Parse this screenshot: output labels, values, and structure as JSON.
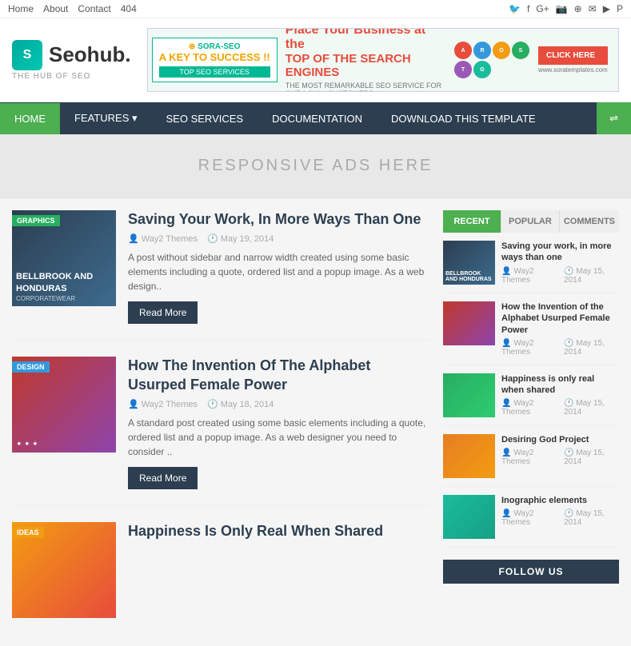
{
  "topNav": {
    "items": [
      "Home",
      "About",
      "Contact",
      "404"
    ]
  },
  "topSocial": {
    "icons": [
      "twitter",
      "facebook",
      "google-plus",
      "instagram",
      "rss",
      "email",
      "youtube",
      "pinterest"
    ]
  },
  "header": {
    "logoText": "Seohub.",
    "logoSub": "THE HUB OF SEO",
    "banner": {
      "leftTop": "SORA-SEO",
      "leftTagline": "A KEY TO SUCCESS !!",
      "leftButton": "TOP SEO SERVICES",
      "midPrefix": "Place Your Business at the",
      "midHighlight": "TOP OF THE SEARCH ENGINES",
      "midSub": "THE MOST REMARKABLE SEO SERVICE FOR OUR LOYAL CUSTOMERS",
      "ctaButton": "CLICK HERE",
      "url": "www.soratemplates.com"
    }
  },
  "nav": {
    "items": [
      {
        "label": "HOME",
        "active": true
      },
      {
        "label": "FEATURES ▾",
        "active": false
      },
      {
        "label": "SEO SERVICES",
        "active": false
      },
      {
        "label": "DOCUMENTATION",
        "active": false
      },
      {
        "label": "DOWNLOAD THIS TEMPLATE",
        "active": false
      }
    ],
    "shuffleIcon": "⇌"
  },
  "adBanner": {
    "text": "RESPONSIVE ADS HERE"
  },
  "posts": [
    {
      "tag": "GRAPHICS",
      "tagType": "graphics",
      "thumbText": "BELLBROOK AND HONDURAS",
      "thumbSub": "CORPORATEWEAR",
      "title": "Saving Your Work, In More Ways Than One",
      "author": "Way2 Themes",
      "date": "May 19, 2014",
      "excerpt": "A post without sidebar and narrow width created using some basic elements including a quote, ordered list and a popup image. As a web design..",
      "readMore": "Read More"
    },
    {
      "tag": "DESIGN",
      "tagType": "design",
      "thumbText": "",
      "thumbSub": "",
      "title": "How The Invention Of The Alphabet Usurped Female Power",
      "author": "Way2 Themes",
      "date": "May 18, 2014",
      "excerpt": "A standard post created using some basic elements including a quote, ordered list and a popup image. As a web designer you need to consider ..",
      "readMore": "Read More"
    },
    {
      "tag": "IDEAS",
      "tagType": "ideas",
      "thumbText": "",
      "thumbSub": "",
      "title": "Happiness Is Only Real When Shared",
      "author": "",
      "date": "",
      "excerpt": "",
      "readMore": ""
    }
  ],
  "sidebar": {
    "tabs": [
      "RECENT",
      "POPULAR",
      "COMMENTS"
    ],
    "activeTab": 0,
    "posts": [
      {
        "title": "Saving your work, in more ways than one",
        "author": "Way2 Themes",
        "date": "May 15, 2014",
        "thumbClass": "st-1"
      },
      {
        "title": "How the Invention of the Alphabet Usurped Female Power",
        "author": "Way2 Themes",
        "date": "May 15, 2014",
        "thumbClass": "st-2"
      },
      {
        "title": "Happiness is only real when shared",
        "author": "Way2 Themes",
        "date": "May 15, 2014",
        "thumbClass": "st-3"
      },
      {
        "title": "Desiring God Project",
        "author": "Way2 Themes",
        "date": "May 15, 2014",
        "thumbClass": "st-4"
      },
      {
        "title": "Inographic elements",
        "author": "Way2 Themes",
        "date": "May 15, 2014",
        "thumbClass": "st-5"
      }
    ],
    "followUs": "FOLLOW US"
  }
}
